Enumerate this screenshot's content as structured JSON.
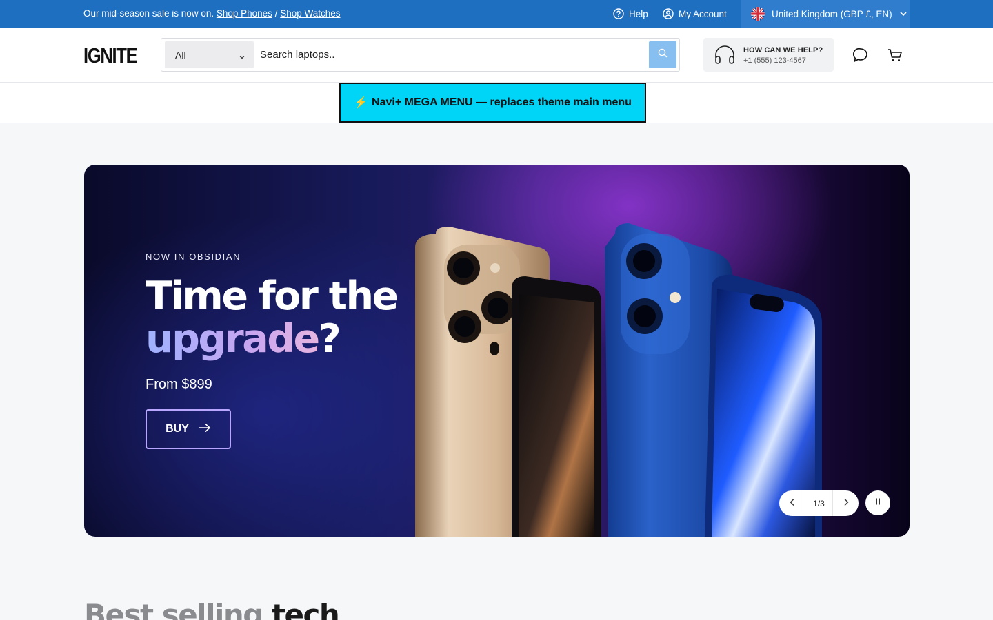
{
  "announcement": {
    "text": "Our mid-season sale is now on.",
    "link_phones": "Shop Phones",
    "separator": "/",
    "link_watches": "Shop Watches"
  },
  "utility_nav": {
    "help": "Help",
    "account": "My Account",
    "region": "United Kingdom (GBP £, EN)"
  },
  "header": {
    "logo": "IGNITE",
    "search": {
      "category": "All",
      "placeholder": "Search laptops.."
    },
    "support": {
      "title": "HOW CAN WE HELP?",
      "phone": "+1 (555) 123-4567"
    }
  },
  "mega_menu": {
    "icon": "⚡",
    "label": "Navi+ MEGA MENU — replaces theme main menu"
  },
  "hero": {
    "eyebrow": "NOW IN OBSIDIAN",
    "headline_line1": "Time for the",
    "headline_highlight": "upgrade",
    "headline_end": "?",
    "price": "From $899",
    "cta": "BUY",
    "slide_counter": "1/3"
  },
  "section": {
    "title_muted": "Best selling",
    "title_strong": "tech"
  },
  "colors": {
    "topbar": "#1f6fc1",
    "mega_menu_bg": "#00d5f7",
    "search_button": "#86bff0"
  }
}
